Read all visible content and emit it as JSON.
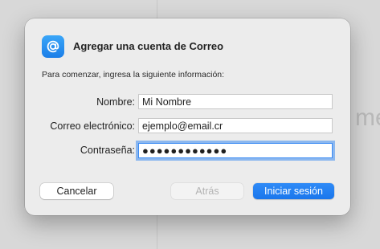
{
  "background": {
    "partial_text": "me"
  },
  "dialog": {
    "title": "Agregar una cuenta de Correo",
    "subtitle": "Para comenzar, ingresa la siguiente información:",
    "app_icon": "at-sign-icon",
    "fields": [
      {
        "label": "Nombre:",
        "value": "Mi Nombre"
      },
      {
        "label": "Correo electrónico:",
        "value": "ejemplo@email.cr"
      },
      {
        "label": "Contraseña:",
        "value": "●●●●●●●●●●●●",
        "focused": true
      }
    ],
    "buttons": {
      "cancel": "Cancelar",
      "back": "Atrás",
      "sign_in": "Iniciar sesión"
    }
  },
  "colors": {
    "accent": "#1a76ec",
    "dialog_bg": "#ececec",
    "desktop_bg": "#d8d8d8"
  }
}
